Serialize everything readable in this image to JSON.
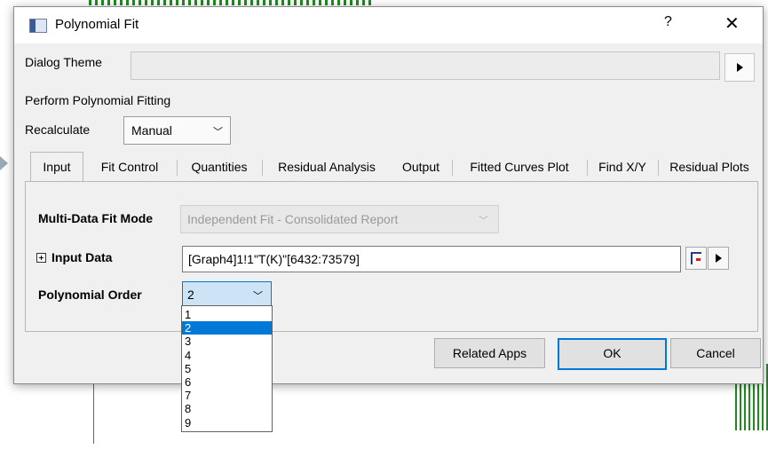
{
  "dialog": {
    "title": "Polynomial Fit",
    "help_label": "?",
    "close_label": "✕"
  },
  "theme": {
    "label": "Dialog Theme",
    "value": ""
  },
  "section_title": "Perform Polynomial Fitting",
  "recalculate": {
    "label": "Recalculate",
    "value": "Manual"
  },
  "tabs": [
    {
      "label": "Input",
      "active": true
    },
    {
      "label": "Fit Control"
    },
    {
      "label": "Quantities"
    },
    {
      "label": "Residual Analysis"
    },
    {
      "label": "Output"
    },
    {
      "label": "Fitted Curves Plot"
    },
    {
      "label": "Find X/Y"
    },
    {
      "label": "Residual Plots"
    }
  ],
  "input_tab": {
    "mode_label": "Multi-Data Fit Mode",
    "mode_value": "Independent Fit - Consolidated Report",
    "input_label": "Input Data",
    "input_value": "[Graph4]1!1\"T(K)\"[6432:73579]",
    "order_label": "Polynomial Order",
    "order_value": "2"
  },
  "order_options": [
    "1",
    "2",
    "3",
    "4",
    "5",
    "6",
    "7",
    "8",
    "9"
  ],
  "order_selected_index": 1,
  "buttons": {
    "related_apps": "Related Apps",
    "ok": "OK",
    "cancel": "Cancel"
  },
  "colors": {
    "accent": "#0078d7",
    "dialog_bg": "#f0f0f0"
  }
}
